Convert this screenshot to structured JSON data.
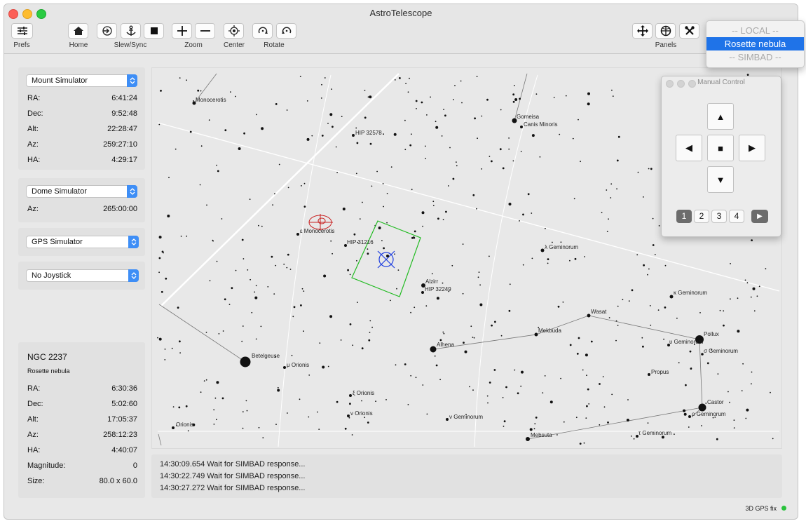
{
  "window": {
    "title": "AstroTelescope"
  },
  "toolbar": {
    "prefs_label": "Prefs",
    "home_label": "Home",
    "slew_sync_label": "Slew/Sync",
    "zoom_label": "Zoom",
    "center_label": "Center",
    "rotate_label": "Rotate",
    "panels_label": "Panels"
  },
  "mount": {
    "device": "Mount Simulator",
    "rows": [
      {
        "label": "RA:",
        "value": "6:41:24"
      },
      {
        "label": "Dec:",
        "value": "9:52:48"
      },
      {
        "label": "Alt:",
        "value": "22:28:47"
      },
      {
        "label": "Az:",
        "value": "259:27:10"
      },
      {
        "label": "HA:",
        "value": "4:29:17"
      }
    ]
  },
  "dome": {
    "device": "Dome Simulator",
    "az_label": "Az:",
    "az_value": "265:00:00"
  },
  "gps": {
    "device": "GPS Simulator"
  },
  "joystick": {
    "device": "No Joystick"
  },
  "target": {
    "name": "NGC 2237",
    "description": "Rosette nebula",
    "rows": [
      {
        "label": "RA:",
        "value": "6:30:36"
      },
      {
        "label": "Dec:",
        "value": "5:02:60"
      },
      {
        "label": "Alt:",
        "value": "17:05:37"
      },
      {
        "label": "Az:",
        "value": "258:12:23"
      },
      {
        "label": "HA:",
        "value": "4:40:07"
      },
      {
        "label": "Magnitude:",
        "value": "0"
      },
      {
        "label": "Size:",
        "value": "80.0 x 60.0"
      }
    ]
  },
  "sky_labels": [
    "Monocerotis",
    "Gomeisa",
    "Canis Minoris",
    "HIP 32578",
    "ε Monocerotis",
    "HIP 31216",
    "λ Geminorum",
    "Alzirr",
    "HIP 32249",
    "κ Geminorum",
    "Wasat",
    "Mekbuda",
    "Alhena",
    "Pollux",
    "υ Geminorum",
    "σ Geminorum",
    "Betelgeuse",
    "μ Orionis",
    "Propus",
    "ξ Orionis",
    "ν Orionis",
    "ν Geminorum",
    "Castor",
    "ρ Geminorum",
    "Orionis",
    "Mebsuta",
    "τ Geminorum"
  ],
  "log": {
    "lines": [
      "14:30:09.654 Wait for SIMBAD response...",
      "14:30:22.749 Wait for SIMBAD response...",
      "14:30:27.272 Wait for SIMBAD response..."
    ]
  },
  "status": {
    "gps_fix": "3D GPS fix",
    "gps_color": "#29c23c"
  },
  "manual_control": {
    "title": "Manual Control",
    "up": "▲",
    "down": "▼",
    "left": "◀",
    "right": "▶",
    "stop": "■",
    "pages": [
      "1",
      "2",
      "3",
      "4"
    ],
    "play": "▶",
    "selected_page": "1"
  },
  "search_dropdown": {
    "items": [
      {
        "label": "-- LOCAL --",
        "state": "disabled"
      },
      {
        "label": "Rosette nebula",
        "state": "selected"
      },
      {
        "label": "-- SIMBAD --",
        "state": "disabled"
      }
    ]
  },
  "colors": {
    "accent": "#1f73e8",
    "fov": "#22bb22",
    "crosshair": "#1f3fe0",
    "target_marker": "#c82020"
  }
}
